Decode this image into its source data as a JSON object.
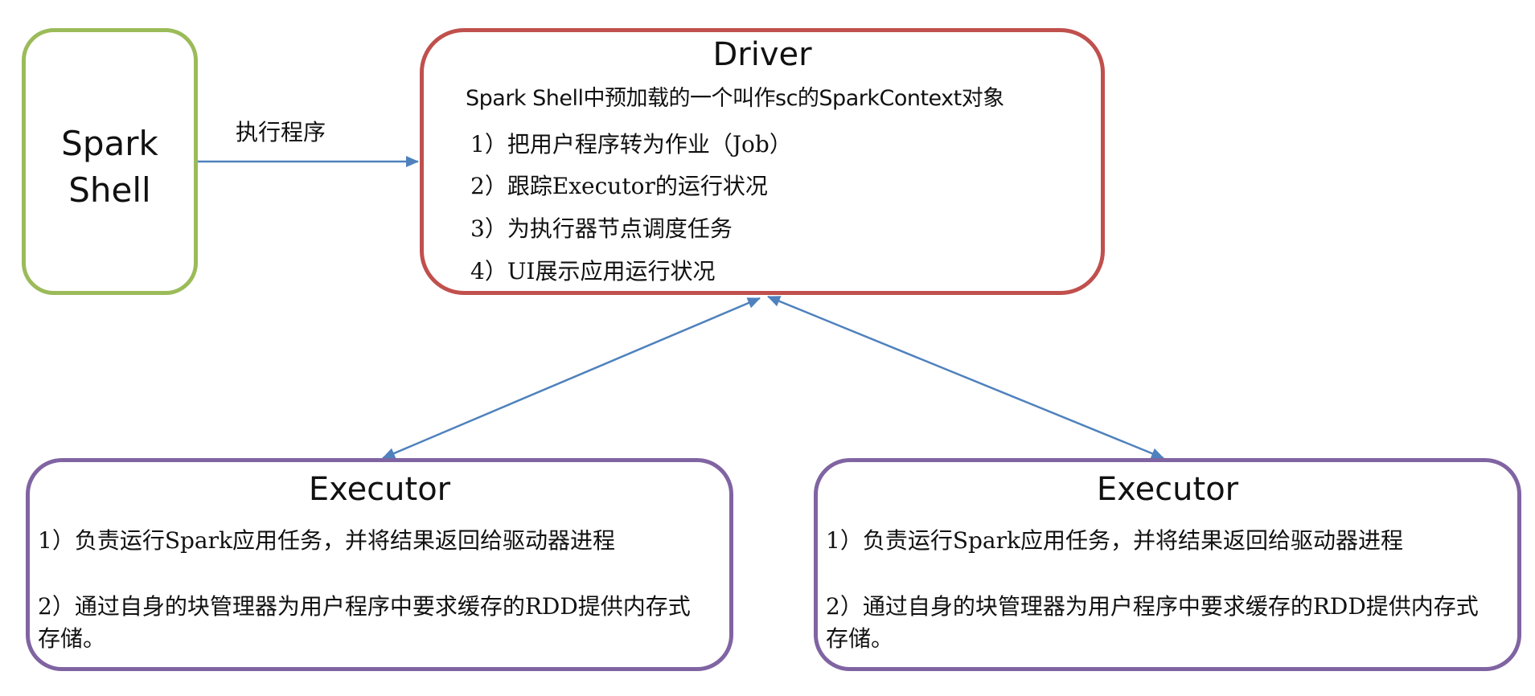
{
  "nodes": {
    "spark_shell": {
      "label_line1": "Spark",
      "label_line2": "Shell",
      "border_color": "#9bbb59"
    },
    "driver": {
      "title": "Driver",
      "subtitle": "Spark Shell中预加载的一个叫作sc的SparkContext对象",
      "items": [
        "1）把用户程序转为作业（Job）",
        "2）跟踪Executor的运行状况",
        "3）为执行器节点调度任务",
        "4）UI展示应用运行状况"
      ],
      "border_color": "#c0504d"
    },
    "executors": [
      {
        "title": "Executor",
        "items": [
          "1）负责运行Spark应用任务，并将结果返回给驱动器进程",
          "2）通过自身的块管理器为用户程序中要求缓存的RDD提供内存式存储。"
        ],
        "border_color": "#8064a2"
      },
      {
        "title": "Executor",
        "items": [
          "1）负责运行Spark应用任务，并将结果返回给驱动器进程",
          "2）通过自身的块管理器为用户程序中要求缓存的RDD提供内存式存储。"
        ],
        "border_color": "#8064a2"
      }
    ]
  },
  "edges": [
    {
      "from": "spark_shell",
      "to": "driver",
      "label": "执行程序",
      "direction": "one-way"
    },
    {
      "from": "driver",
      "to": "executor_1",
      "label": "",
      "direction": "two-way"
    },
    {
      "from": "driver",
      "to": "executor_2",
      "label": "",
      "direction": "two-way"
    }
  ],
  "edge_color": "#4f81bd"
}
